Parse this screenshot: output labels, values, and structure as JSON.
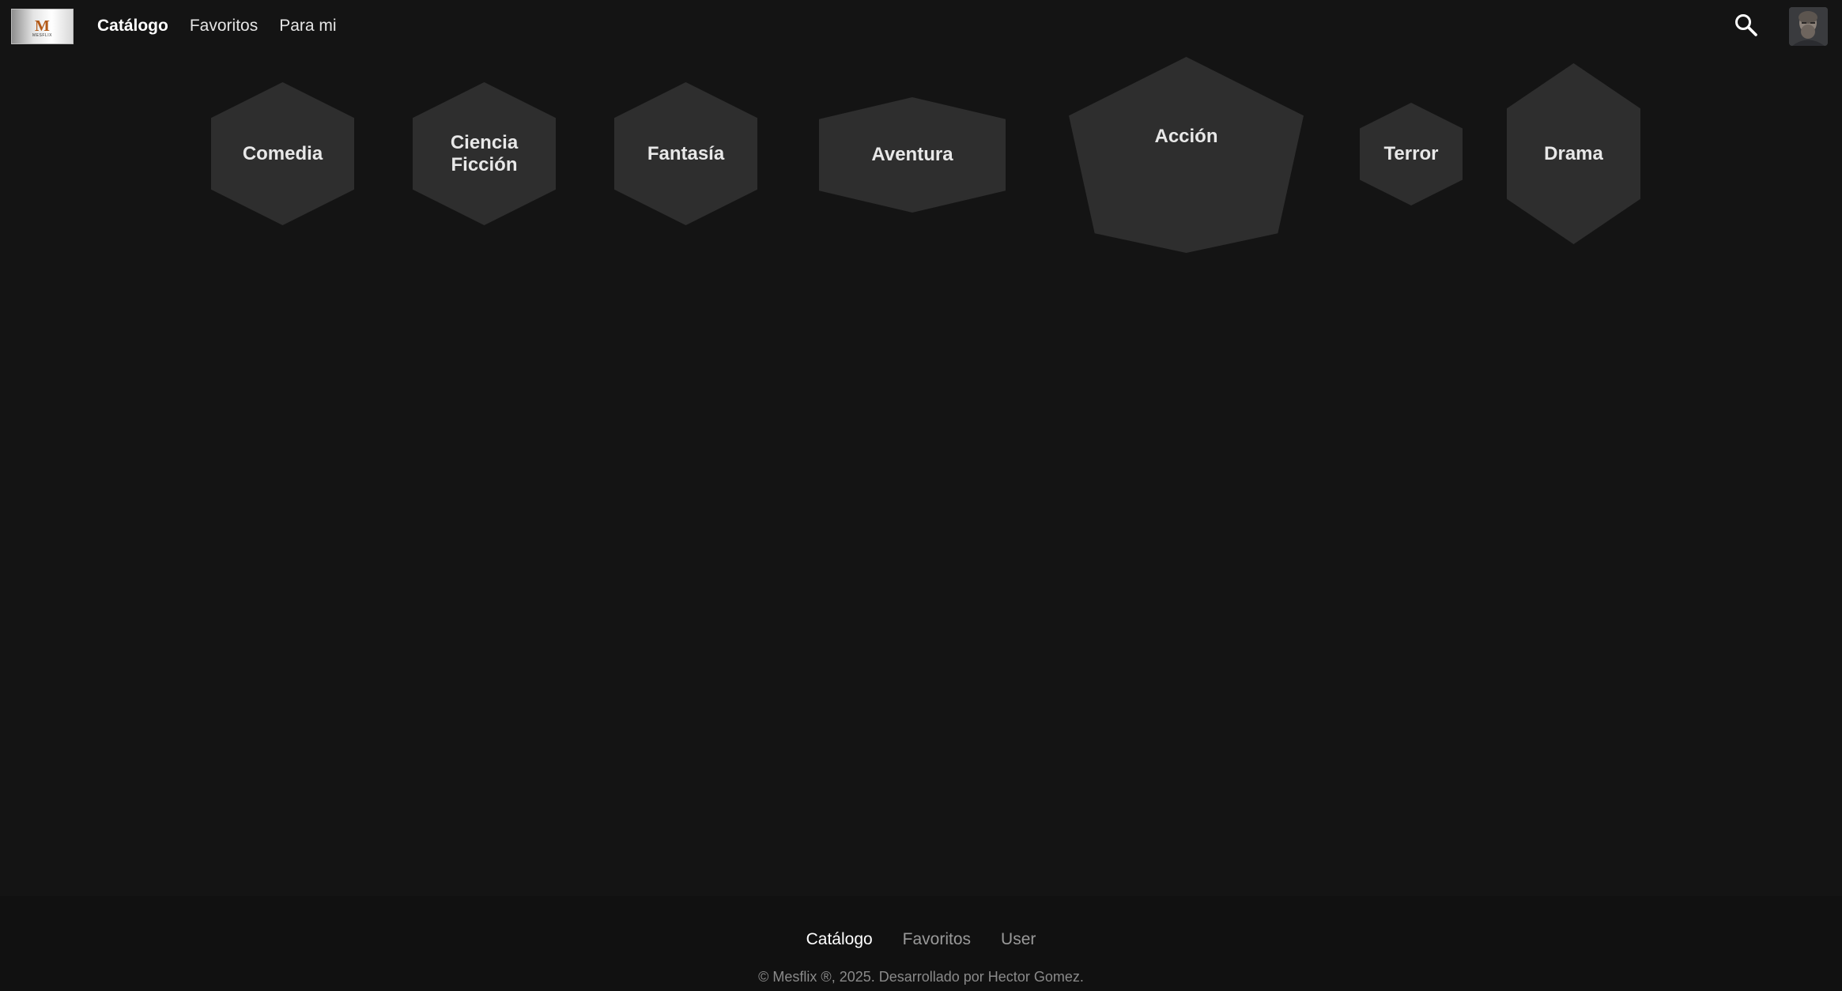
{
  "header": {
    "logo": {
      "mark": "M",
      "text": "MESFLIX",
      "icon": "mesflix-logo"
    },
    "nav": [
      {
        "label": "Catálogo",
        "active": true
      },
      {
        "label": "Favoritos",
        "active": false
      },
      {
        "label": "Para mi",
        "active": false
      }
    ],
    "search_icon": "search-icon",
    "avatar_icon": "user-avatar"
  },
  "genres": [
    {
      "label": "Comedia"
    },
    {
      "label": "Ciencia Ficción"
    },
    {
      "label": "Fantasía"
    },
    {
      "label": "Aventura"
    },
    {
      "label": "Acción"
    },
    {
      "label": "Terror"
    },
    {
      "label": "Drama"
    }
  ],
  "footer": {
    "links": [
      {
        "label": "Catálogo",
        "active": true
      },
      {
        "label": "Favoritos",
        "active": false
      },
      {
        "label": "User",
        "active": false
      }
    ],
    "copyright": "© Mesflix ®, 2025. Desarrollado por Hector Gomez."
  },
  "colors": {
    "background": "#141414",
    "footer_background": "#111111",
    "genre_tile": "#2e2e2e",
    "text_primary": "#ffffff",
    "text_muted": "#9a9a9a"
  }
}
